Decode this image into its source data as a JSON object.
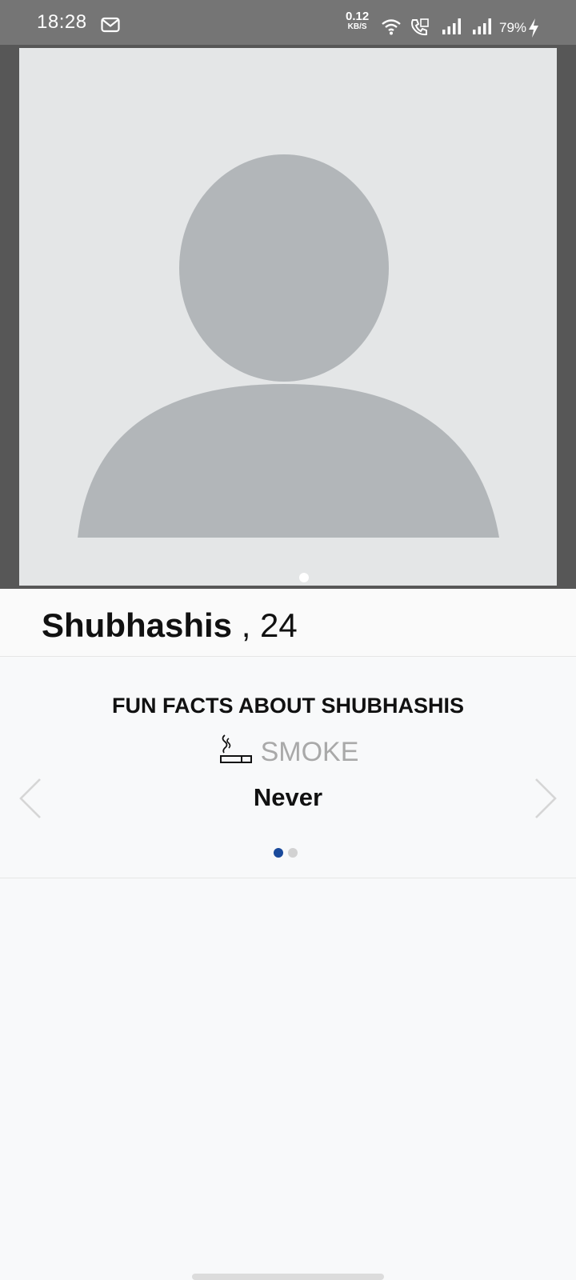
{
  "status_bar": {
    "time": "18:28",
    "speed_value": "0.12",
    "speed_unit": "KB/S",
    "battery": "79%",
    "icons": [
      "gmail-icon",
      "wifi-icon",
      "volte-call-icon",
      "signal-icon",
      "signal-icon",
      "charging-icon"
    ]
  },
  "profile": {
    "name": "Shubhashis",
    "age_text": " , 24",
    "photo_icon": "avatar-placeholder-icon",
    "photo_page_indicator": {
      "count": 1,
      "active": 0
    }
  },
  "fun_facts": {
    "title": "FUN FACTS ABOUT SHUBHASHIS",
    "items": [
      {
        "icon": "cigarette-icon",
        "label": "SMOKE",
        "value": "Never"
      }
    ],
    "page_indicator": {
      "count": 2,
      "active": 0
    },
    "prev_icon": "chevron-left-icon",
    "next_icon": "chevron-right-icon"
  },
  "colors": {
    "status_bar": "#757575",
    "photo_background": "#e4e6e7",
    "avatar_silhouette": "#b2b6b9",
    "label_grey": "#a9a9a9",
    "dot_active": "#1a4a9b",
    "dot_inactive": "#d2d2d2",
    "page_background": "#f8f9fa"
  }
}
